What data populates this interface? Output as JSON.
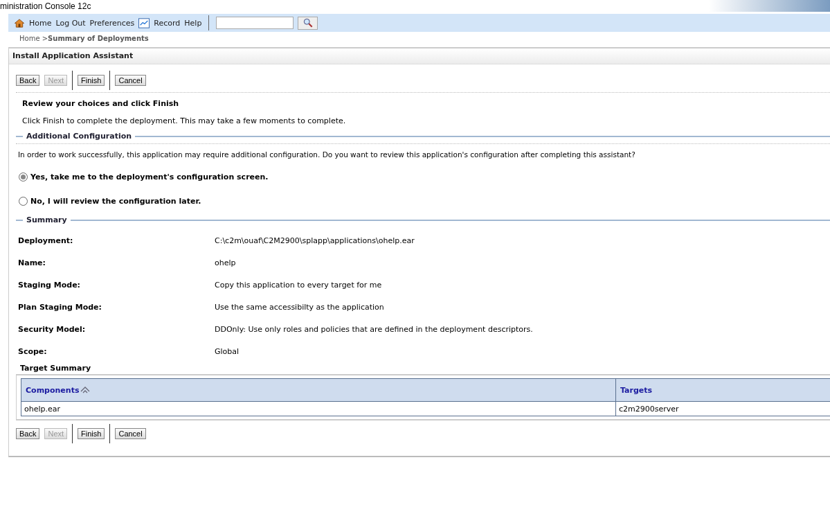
{
  "window": {
    "title": "ministration Console 12c"
  },
  "toolbar": {
    "items": [
      {
        "kind": "home",
        "label": "Home"
      },
      {
        "kind": "link",
        "label": "Log Out"
      },
      {
        "kind": "link",
        "label": "Preferences"
      },
      {
        "kind": "record",
        "label": "Record"
      },
      {
        "kind": "link",
        "label": "Help"
      }
    ]
  },
  "breadcrumb": {
    "home": "Home >",
    "current": "Summary of Deployments"
  },
  "panel": {
    "title": "Install Application Assistant",
    "top_buttons": [
      {
        "label": "Back",
        "disabled": false
      },
      {
        "label": "Next",
        "disabled": true
      },
      {
        "label": "Finish",
        "disabled": false
      },
      {
        "label": "Cancel",
        "disabled": false
      }
    ],
    "heading": "Review your choices and click Finish",
    "intro": "Click Finish to complete the deployment. This may take a few moments to complete.",
    "additional": {
      "title": "Additional Configuration",
      "question": "In order to work successfully, this application may require additional configuration. Do you want to review this application's configuration after completing this assistant?",
      "options": [
        {
          "label": "Yes, take me to the deployment's configuration screen.",
          "selected": true
        },
        {
          "label": "No, I will review the configuration later.",
          "selected": false
        }
      ]
    },
    "summary": {
      "title": "Summary",
      "rows": [
        {
          "label": "Deployment:",
          "value": "C:\\c2m\\ouaf\\C2M2900\\splapp\\applications\\ohelp.ear"
        },
        {
          "label": "Name:",
          "value": "ohelp"
        },
        {
          "label": "Staging Mode:",
          "value": "Copy this application to every target for me"
        },
        {
          "label": "Plan Staging Mode:",
          "value": "Use the same accessibilty as the application"
        },
        {
          "label": "Security Model:",
          "value": "DDOnly: Use only roles and policies that are defined in the deployment descriptors."
        },
        {
          "label": "Scope:",
          "value": "Global"
        }
      ]
    },
    "target_summary": {
      "title": "Target Summary",
      "columns": [
        "Components",
        "Targets"
      ],
      "rows": [
        [
          "ohelp.ear",
          "c2m2900server"
        ]
      ]
    },
    "bottom_buttons": [
      {
        "label": "Back",
        "disabled": false
      },
      {
        "label": "Next",
        "disabled": true
      },
      {
        "label": "Finish",
        "disabled": false
      },
      {
        "label": "Cancel",
        "disabled": false
      }
    ]
  }
}
